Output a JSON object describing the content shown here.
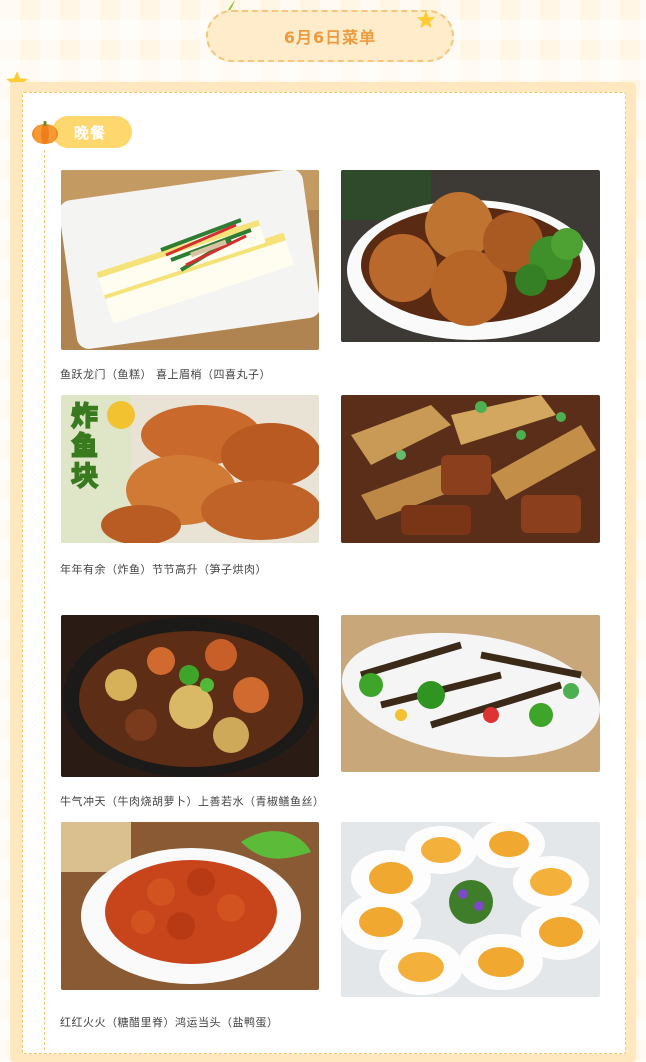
{
  "header": {
    "title": "6月6日菜单"
  },
  "section": {
    "label": "晚餐"
  },
  "dishes": [
    {
      "image": "fish-cake-plate",
      "caption_row": 0
    },
    {
      "image": "four-joy-meatballs",
      "caption_row": 0
    },
    {
      "image": "fried-fish-pieces",
      "caption_row": 1,
      "overlay_text": "炸鱼块"
    },
    {
      "image": "bamboo-shoot-pork",
      "caption_row": 1
    },
    {
      "image": "beef-carrot-stew",
      "caption_row": 2
    },
    {
      "image": "pepper-eel-strips",
      "caption_row": 2
    },
    {
      "image": "sweet-sour-pork",
      "caption_row": 3
    },
    {
      "image": "salted-duck-eggs",
      "caption_row": 3
    }
  ],
  "captions": [
    "鱼跃龙门（鱼糕） 喜上眉梢（四喜丸子）",
    "年年有余（炸鱼）节节高升（笋子烘肉）",
    "牛气冲天（牛肉烧胡萝卜）上善若水（青椒鳝鱼丝）",
    "红红火火（糖醋里脊）鸿运当头（盐鸭蛋）"
  ],
  "colors": {
    "accent": "#f09a3e",
    "pill": "#ffd76f",
    "border": "#f6c46a",
    "background": "#fff6e6"
  }
}
